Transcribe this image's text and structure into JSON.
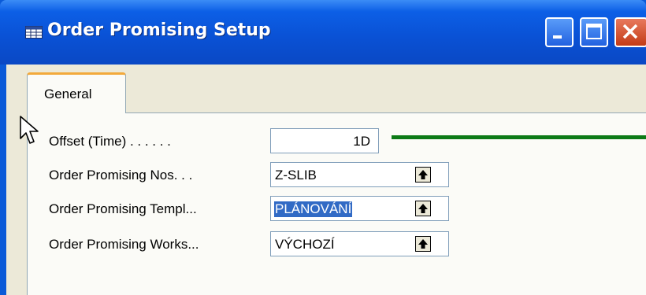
{
  "window": {
    "title": "Order Promising Setup",
    "icons": [
      "table-icon",
      "minimize-icon",
      "maximize-icon",
      "close-icon"
    ]
  },
  "tabs": [
    {
      "label": "General",
      "active": true
    }
  ],
  "fields": [
    {
      "label": "Offset (Time) . . . . . .",
      "value": "1D"
    },
    {
      "label": "Order Promising Nos. . .",
      "value": "Z-SLIB"
    },
    {
      "label": "Order Promising Templ...",
      "value": "PLÁNOVÁNÍ",
      "selected": true
    },
    {
      "label": "Order Promising Works...",
      "value": "VÝCHOZÍ"
    }
  ],
  "colors": {
    "titlebar": "#0a52d6",
    "client": "#ece9d8",
    "selection": "#316ac5",
    "annotation_line": "#0c7a16",
    "tab_highlight": "#f2a93b"
  }
}
